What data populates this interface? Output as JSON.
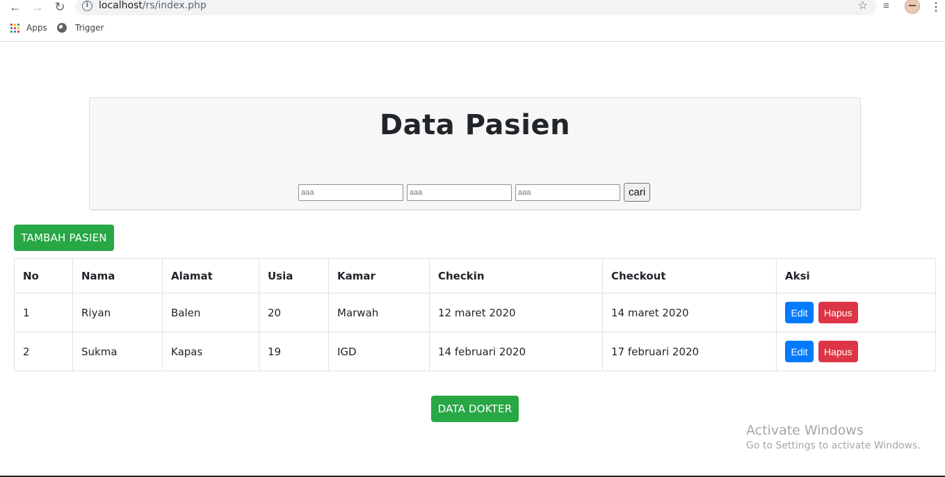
{
  "browser": {
    "url_host": "localhost",
    "url_path": "/rs/index.php",
    "bookmarks": [
      {
        "label": "Apps"
      },
      {
        "label": "Trigger"
      }
    ]
  },
  "header": {
    "title": "Data Pasien",
    "search_inputs": [
      {
        "placeholder": "aaa"
      },
      {
        "placeholder": "aaa"
      },
      {
        "placeholder": "aaa"
      }
    ],
    "search_button": "cari"
  },
  "actions": {
    "add_patient": "TAMBAH PASIEN",
    "doctor_data": "DATA DOKTER"
  },
  "table": {
    "columns": [
      "No",
      "Nama",
      "Alamat",
      "Usia",
      "Kamar",
      "Checkin",
      "Checkout",
      "Aksi"
    ],
    "rows": [
      {
        "no": "1",
        "nama": "Riyan",
        "alamat": "Balen",
        "usia": "20",
        "kamar": "Marwah",
        "checkin": "12 maret 2020",
        "checkout": "14 maret 2020",
        "edit": "Edit",
        "hapus": "Hapus"
      },
      {
        "no": "2",
        "nama": "Sukma",
        "alamat": "Kapas",
        "usia": "19",
        "kamar": "IGD",
        "checkin": "14 februari 2020",
        "checkout": "17 februari 2020",
        "edit": "Edit",
        "hapus": "Hapus"
      }
    ]
  },
  "watermark": {
    "title": "Activate Windows",
    "subtitle": "Go to Settings to activate Windows."
  },
  "colors": {
    "success": "#28a745",
    "primary": "#007bff",
    "danger": "#dc3545"
  }
}
